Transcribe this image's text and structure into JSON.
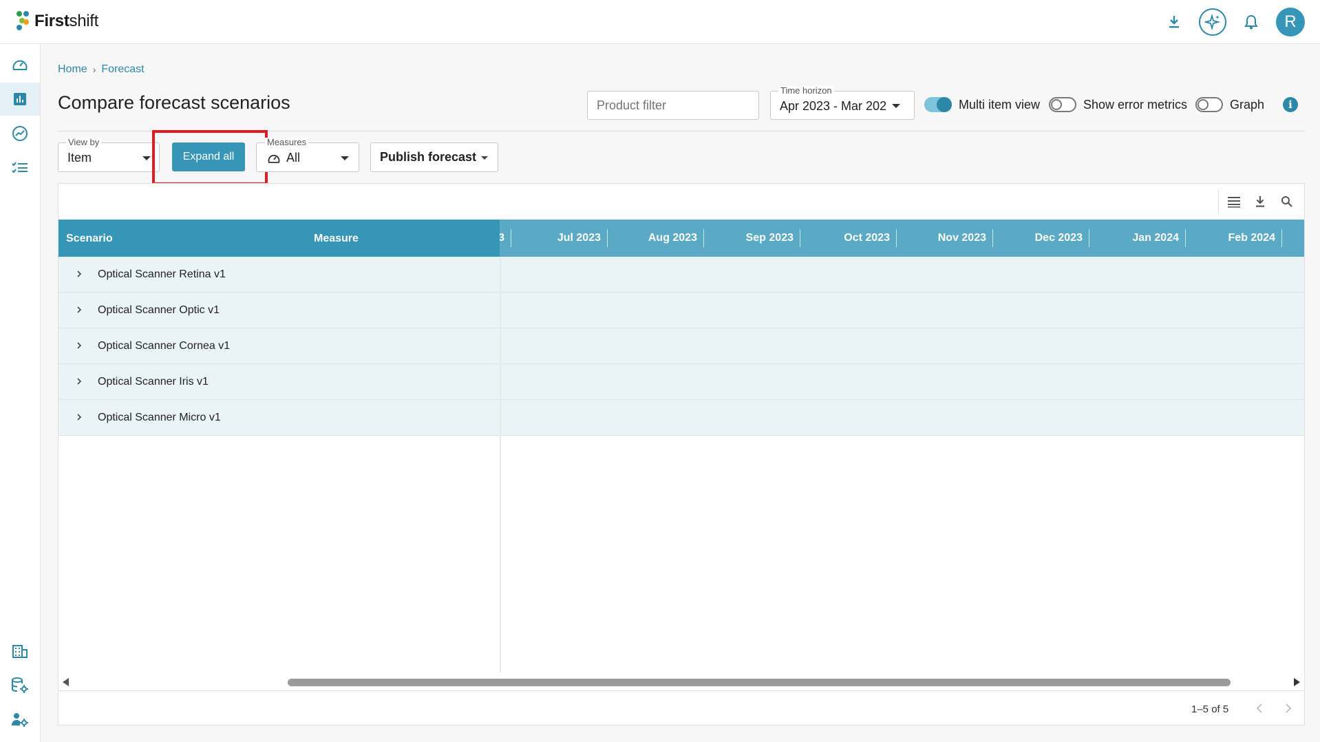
{
  "app": {
    "brand_bold": "First",
    "brand_light": "shift",
    "avatar_initial": "R"
  },
  "breadcrumb": {
    "home": "Home",
    "separator": "›",
    "current": "Forecast"
  },
  "page": {
    "title": "Compare forecast scenarios"
  },
  "filters": {
    "product_filter_placeholder": "Product filter",
    "time_horizon_label": "Time horizon",
    "time_horizon_value": "Apr 2023 - Mar 202",
    "multi_item_view": {
      "label": "Multi item view",
      "on": true
    },
    "show_error_metrics": {
      "label": "Show error metrics",
      "on": false
    },
    "graph": {
      "label": "Graph",
      "on": false
    }
  },
  "toolbar": {
    "view_by_label": "View by",
    "view_by_value": "Item",
    "expand_all": "Expand all",
    "measures_label": "Measures",
    "measures_value": "All",
    "publish_forecast": "Publish forecast"
  },
  "grid": {
    "col_scenario": "Scenario",
    "col_measure": "Measure",
    "partial_month": "3",
    "months": [
      "Jul 2023",
      "Aug 2023",
      "Sep 2023",
      "Oct 2023",
      "Nov 2023",
      "Dec 2023",
      "Jan 2024",
      "Feb 2024"
    ],
    "rows": [
      "Optical Scanner Retina v1",
      "Optical Scanner Optic v1",
      "Optical Scanner Cornea v1",
      "Optical Scanner Iris v1",
      "Optical Scanner Micro v1"
    ],
    "pagination": "1–5 of 5"
  },
  "colors": {
    "accent": "#3596b8",
    "header_secondary": "#5aaac6",
    "row_bg": "#eaf4f7",
    "highlight": "#e01b24"
  }
}
